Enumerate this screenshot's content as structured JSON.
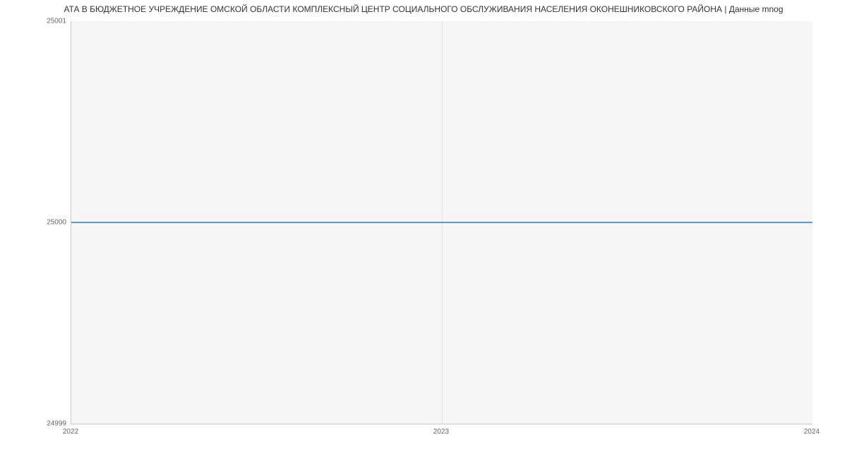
{
  "chart_data": {
    "type": "line",
    "title": "АТА В БЮДЖЕТНОЕ УЧРЕЖДЕНИЕ ОМСКОЙ ОБЛАСТИ КОМПЛЕКСНЫЙ ЦЕНТР СОЦИАЛЬНОГО ОБСЛУЖИВАНИЯ НАСЕЛЕНИЯ ОКОНЕШНИКОВСКОГО РАЙОНА | Данные mnog",
    "x": [
      2022,
      2023,
      2024
    ],
    "series": [
      {
        "name": "value",
        "values": [
          25000,
          25000,
          25000
        ],
        "color": "#5b9bd5"
      }
    ],
    "xlabel": "",
    "ylabel": "",
    "ylim": [
      24999,
      25001
    ],
    "xlim": [
      2022,
      2024
    ],
    "x_ticks": [
      2022,
      2023,
      2024
    ],
    "y_ticks": [
      24999,
      25000,
      25001
    ],
    "grid": {
      "x": true,
      "y": false
    }
  }
}
